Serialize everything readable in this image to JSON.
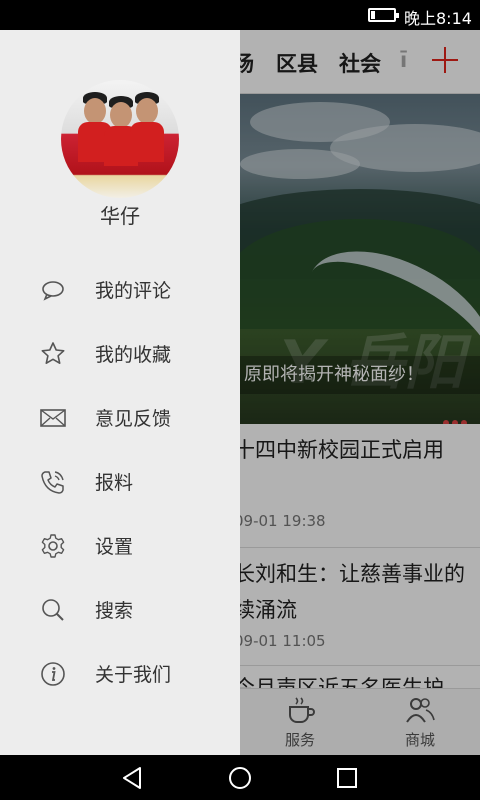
{
  "status_bar": {
    "time": "晚上8:14",
    "battery_fraction": 0.2
  },
  "background_app": {
    "categories": [
      "场",
      "区县",
      "社会",
      "ī"
    ],
    "banner": {
      "caption": "原即将揭开神秘面纱！",
      "watermark": "Y 岳阳"
    },
    "news": [
      {
        "title": "十四中新校园正式启用",
        "date": "09-01 19:38"
      },
      {
        "title": "长刘和生：让慈善事业的",
        "title_line2": "续涌流",
        "date": "09-01 11:05"
      },
      {
        "title": "今月声区近五名医生护"
      }
    ],
    "bottom_nav": [
      {
        "label": "服务",
        "icon": "coffee-icon"
      },
      {
        "label": "商城",
        "icon": "users-icon"
      }
    ]
  },
  "drawer": {
    "username": "华仔",
    "menu": [
      {
        "label": "我的评论",
        "icon": "comment-icon"
      },
      {
        "label": "我的收藏",
        "icon": "star-icon"
      },
      {
        "label": "意见反馈",
        "icon": "mail-icon"
      },
      {
        "label": "报料",
        "icon": "phone-icon"
      },
      {
        "label": "设置",
        "icon": "gear-icon"
      },
      {
        "label": "搜索",
        "icon": "search-icon"
      },
      {
        "label": "关于我们",
        "icon": "info-icon"
      }
    ]
  },
  "colors": {
    "accent": "#e2231a",
    "drawer_bg": "#ededed"
  }
}
